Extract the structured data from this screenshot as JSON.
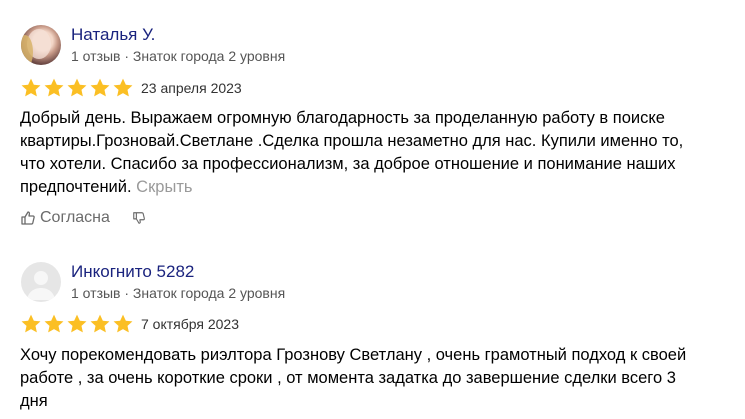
{
  "reviews": [
    {
      "author": "Наталья У.",
      "meta": "1 отзыв · Знаток города 2 уровня",
      "rating": 5,
      "date": "23 апреля 2023",
      "text": "Добрый день. Выражаем огромную благодарность за проделанную работу в поиске квартиры.Грознoвай.Светлане .Сделка прошла незаметно для нас. Купили именно то, что хотели. Спасибо за профессионализм, за доброе отношение и понимание наших предпочтений.",
      "hide_label": "Скрыть",
      "like_label": "Согласна"
    },
    {
      "author": "Инкогнито 5282",
      "meta": "1 отзыв · Знаток города 2 уровня",
      "rating": 5,
      "date": "7 октября 2023",
      "text": "Хочу порекомендовать риэлтора Грознову Светлану , очень грамотный подход к своей работе , за очень короткие сроки , от момента задатка до завершение сделки всего 3 дня"
    }
  ],
  "colors": {
    "star": "#fbbf24",
    "author": "#1a237e",
    "muted": "#9a9a9a"
  }
}
